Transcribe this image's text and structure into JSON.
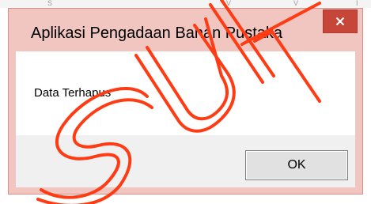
{
  "background": {
    "fragments": [
      "S",
      "V",
      "V",
      "I"
    ]
  },
  "dialog": {
    "title": "Aplikasi Pengadaan Bahan Pustaka",
    "close_icon": "close-icon",
    "message": "Data Terhapus",
    "ok_label": "OK"
  },
  "colors": {
    "titlebar": "#f2c6c0",
    "close_button": "#c7463a",
    "button_area": "#f0f0f0",
    "ok_button": "#e1e1e1",
    "watermark_stroke": "#ff3b14"
  },
  "watermark": {
    "text": "SUK"
  }
}
